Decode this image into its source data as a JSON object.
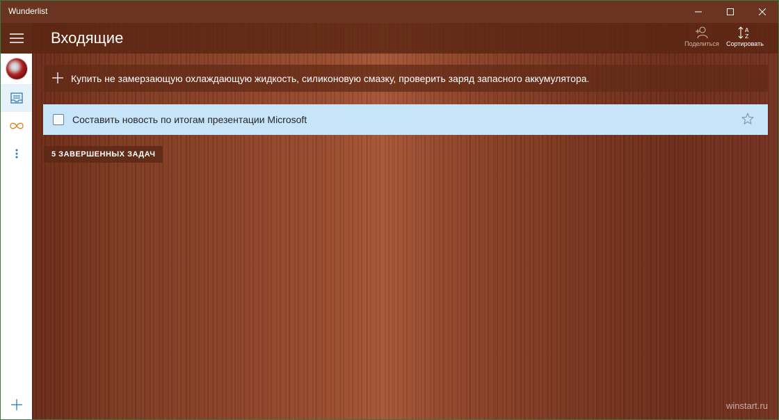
{
  "window": {
    "title": "Wunderlist"
  },
  "header": {
    "list_title": "Входящие",
    "share_label": "Поделиться",
    "sort_label": "Сортировать"
  },
  "add_task": {
    "text": "Купить не замерзающую охлаждающую жидкость, силиконовую смазку, проверить заряд запасного аккумулятора."
  },
  "tasks": [
    {
      "title": "Составить новость по итогам презентации Microsoft",
      "completed": false,
      "starred": false
    }
  ],
  "completed_toggle": {
    "label": "5 ЗАВЕРШЕННЫХ ЗАДАЧ"
  },
  "sidebar": {
    "icons": [
      "menu-icon",
      "avatar",
      "inbox-icon",
      "infinity-icon",
      "more-vertical-icon",
      "plus-icon"
    ]
  },
  "watermark": "winstart.ru",
  "colors": {
    "titlebar": "#6a3421",
    "task_row": "#c8e4f9",
    "sidebar_active": "#e6f1fa",
    "accent": "#2b7bb9",
    "infinity": "#d08a2a"
  }
}
